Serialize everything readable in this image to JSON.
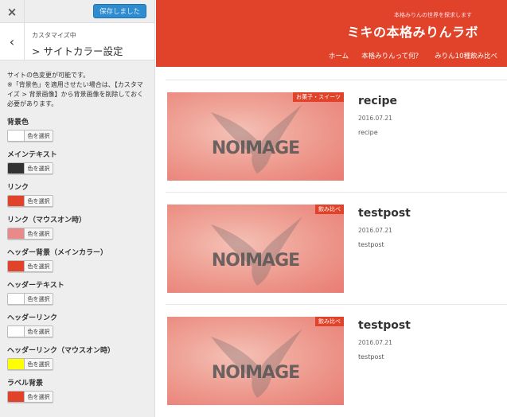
{
  "panel": {
    "close_icon": "×",
    "saved_label": "保存しました",
    "back_icon": "‹",
    "breadcrumb": "カスタマイズ中",
    "section_title": "> サイトカラー設定",
    "description": "サイトの色変更が可能です。\n※「背景色」を適用させたい場合は、【カスタマイズ > 背景画像】から背景画像を削除しておく必要があります。",
    "picker_label": "色を選択",
    "settings": [
      {
        "label": "背景色",
        "color": "#ffffff"
      },
      {
        "label": "メインテキスト",
        "color": "#333333"
      },
      {
        "label": "リンク",
        "color": "#e04329"
      },
      {
        "label": "リンク（マウスオン時）",
        "color": "#e88a8a"
      },
      {
        "label": "ヘッダー背景（メインカラー）",
        "color": "#e04329"
      },
      {
        "label": "ヘッダーテキスト",
        "color": "#ffffff"
      },
      {
        "label": "ヘッダーリンク",
        "color": "#ffffff"
      },
      {
        "label": "ヘッダーリンク（マウスオン時）",
        "color": "#ffff00"
      },
      {
        "label": "ラベル背景",
        "color": "#e04329"
      }
    ]
  },
  "site": {
    "tagline": "本格みりんの世界を探求します",
    "title": "ミキの本格みりんラボ",
    "header_color": "#e04329",
    "nav": [
      "ホーム",
      "本格みりんって何？",
      "みりん10種飲み比べ"
    ]
  },
  "posts": [
    {
      "category": "お菓子・スイーツ",
      "title": "recipe",
      "date": "2016.07.21",
      "excerpt": "recipe",
      "thumb_text": "NOIMAGE"
    },
    {
      "category": "飲み比べ",
      "title": "testpost",
      "date": "2016.07.21",
      "excerpt": "testpost",
      "thumb_text": "NOIMAGE"
    },
    {
      "category": "飲み比べ",
      "title": "testpost",
      "date": "2016.07.21",
      "excerpt": "testpost",
      "thumb_text": "NOIMAGE"
    }
  ]
}
